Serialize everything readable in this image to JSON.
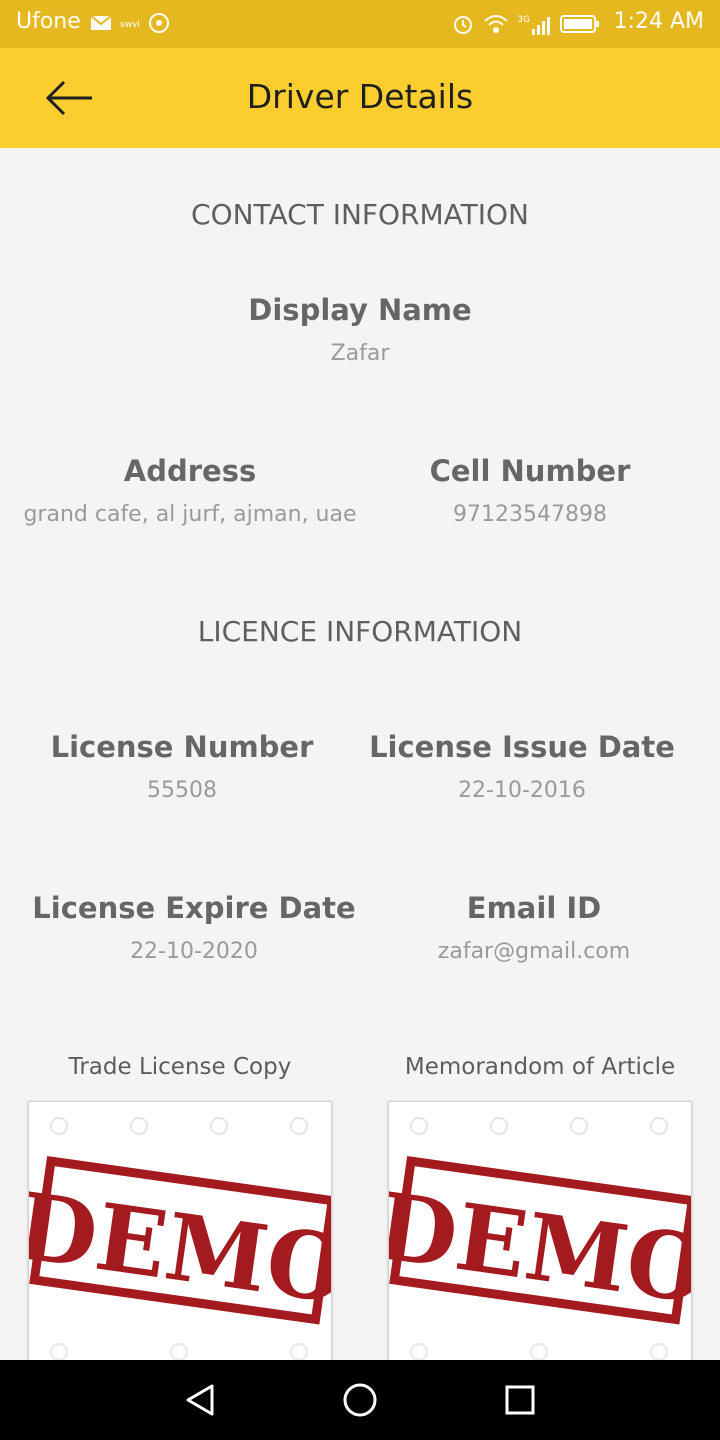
{
  "status_bar": {
    "carrier": "Ufone",
    "time": "1:24 AM",
    "left_icons": [
      "mail-icon",
      "swvl-icon",
      "imo-icon"
    ],
    "right_icons": [
      "alarm-icon",
      "wifi-icon",
      "signal-3g-icon",
      "battery-icon"
    ],
    "network_label": "3G",
    "swvl_label": "swvl"
  },
  "app_bar": {
    "title": "Driver Details",
    "back_icon": "arrow-left-icon"
  },
  "contact_section": {
    "title": "CONTACT INFORMATION",
    "display_name": {
      "label": "Display Name",
      "value": "Zafar"
    },
    "address": {
      "label": "Address",
      "value": "grand cafe, al jurf, ajman, uae"
    },
    "cell_number": {
      "label": "Cell Number",
      "value": "97123547898"
    }
  },
  "licence_section": {
    "title": "LICENCE INFORMATION",
    "license_number": {
      "label": "License Number",
      "value": "55508"
    },
    "issue_date": {
      "label": "License Issue Date",
      "value": "22-10-2016"
    },
    "expire_date": {
      "label": "License Expire Date",
      "value": "22-10-2020"
    },
    "email": {
      "label": "Email ID",
      "value": "zafar@gmail.com"
    }
  },
  "documents": [
    {
      "label": "Trade License Copy",
      "image_text": "DEMO"
    },
    {
      "label": "Memorandom of Article",
      "image_text": "DEMO"
    }
  ],
  "nav_bar": {
    "icons": [
      "back-triangle-icon",
      "home-circle-icon",
      "recents-square-icon"
    ]
  },
  "colors": {
    "status_bar": "#e6b820",
    "app_bar": "#fbcd2f",
    "background": "#f4f4f4",
    "stamp_red": "#a31b1e"
  }
}
